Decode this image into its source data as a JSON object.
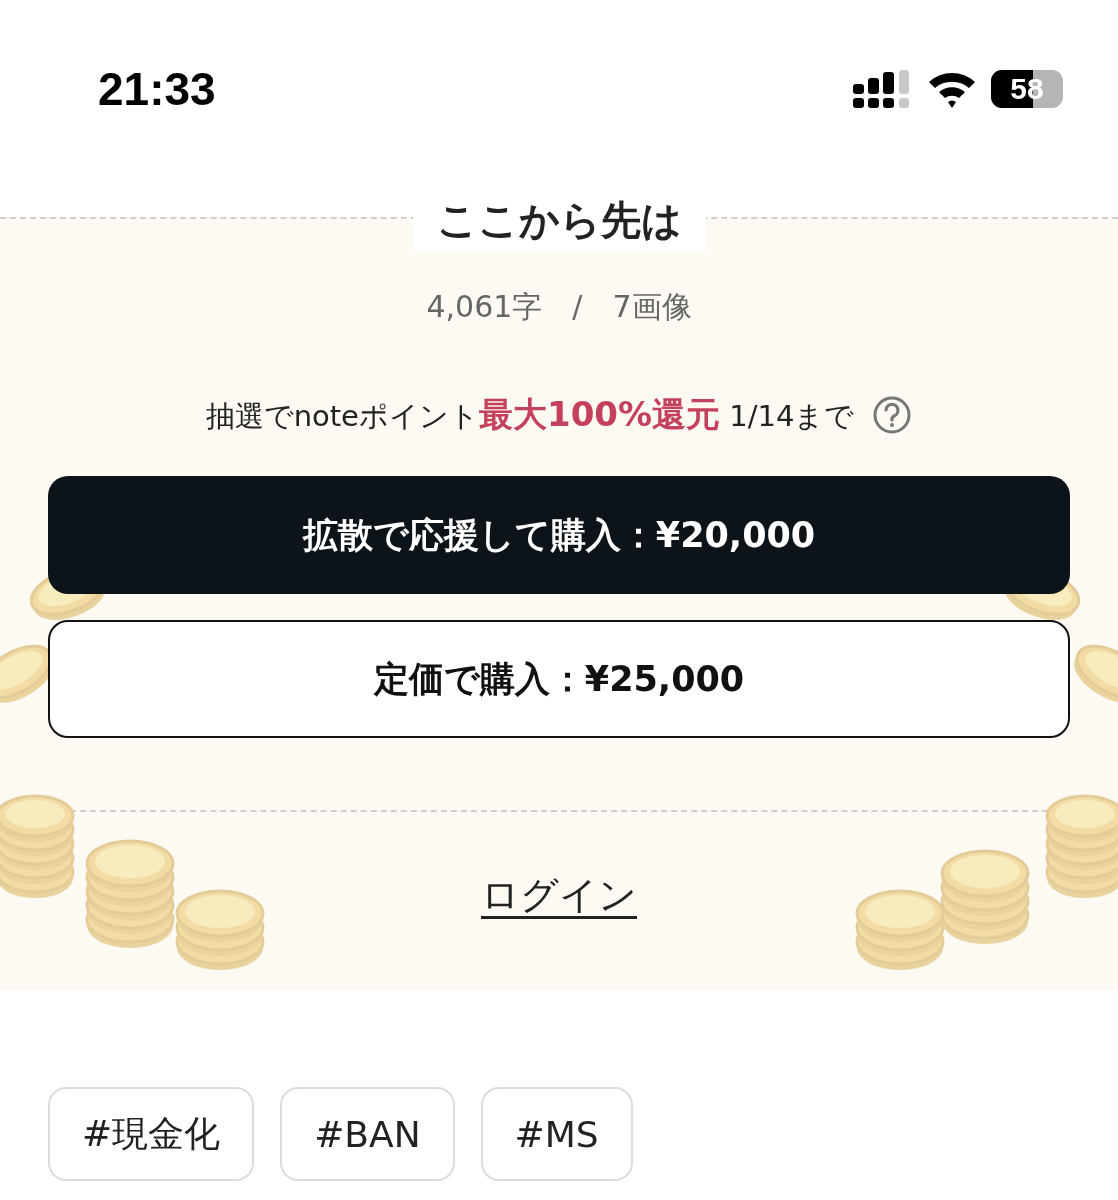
{
  "status_bar": {
    "time": "21:33",
    "battery": "58"
  },
  "paywall": {
    "title": "ここから先は",
    "stats": "4,061字　/　7画像",
    "campaign": "抽選でnoteポイント**最大100%還元** 1/14まで",
    "buttons": [
      {
        "kind": "primary",
        "label": "拡散で応援して購入：¥20,000"
      },
      {
        "kind": "secondary",
        "label": "定価で購入：¥25,000"
      }
    ],
    "login": "ログイン"
  },
  "tags": [
    "#現金化",
    "#BAN",
    "#MS"
  ]
}
